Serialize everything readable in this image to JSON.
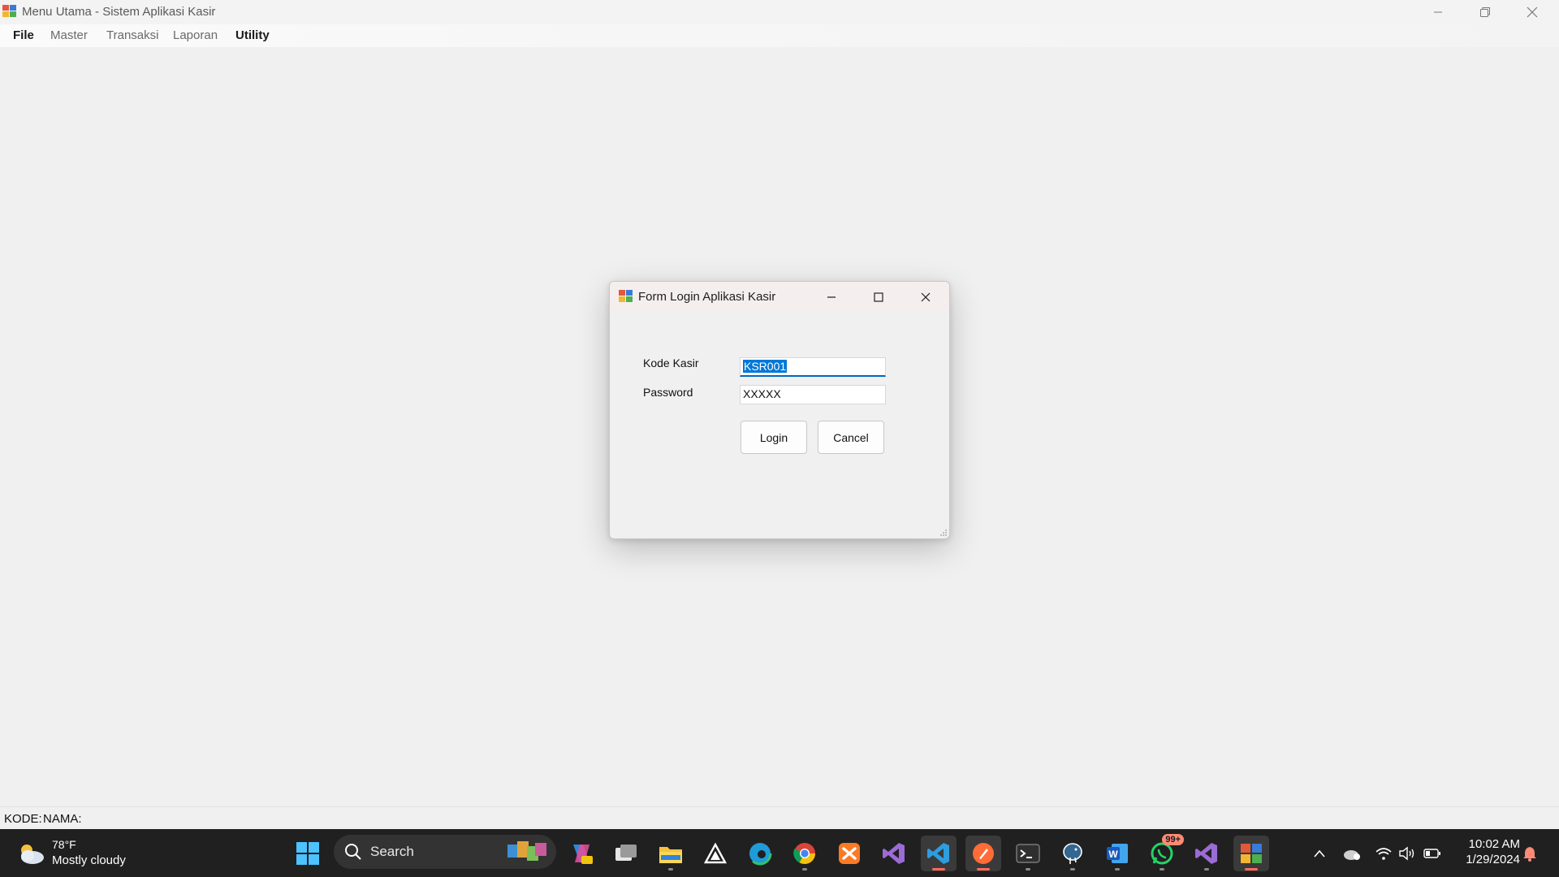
{
  "window": {
    "title": "Menu Utama - Sistem Aplikasi Kasir"
  },
  "menu": {
    "items": [
      {
        "label": "File"
      },
      {
        "label": "Master"
      },
      {
        "label": "Transaksi"
      },
      {
        "label": "Laporan"
      },
      {
        "label": "Utility"
      }
    ]
  },
  "statusbar": {
    "kode_label": "KODE:",
    "nama_label": "NAMA:"
  },
  "login": {
    "title": "Form Login Aplikasi Kasir",
    "kode_label": "Kode Kasir",
    "kode_value": "KSR001",
    "password_label": "Password",
    "password_value": "XXXXX",
    "login_button": "Login",
    "cancel_button": "Cancel"
  },
  "taskbar": {
    "weather_temp": "78°F",
    "weather_condition": "Mostly cloudy",
    "search_placeholder": "Search",
    "whatsapp_badge": "99+",
    "time": "10:02 AM",
    "date": "1/29/2024",
    "icons": [
      "windows-start-icon",
      "search-icon",
      "copilot-icon",
      "task-view-icon",
      "file-explorer-icon",
      "unity-icon",
      "edge-icon",
      "chrome-icon",
      "xampp-icon",
      "visual-studio-icon",
      "vscode-icon",
      "postman-icon",
      "terminal-icon",
      "postgresql-icon",
      "word-icon",
      "whatsapp-icon",
      "visual-studio-2-icon",
      "kasir-app-icon"
    ]
  },
  "colors": {
    "accent": "#0078d7",
    "taskbar": "#202020",
    "window_bg": "#f0f0f0"
  }
}
